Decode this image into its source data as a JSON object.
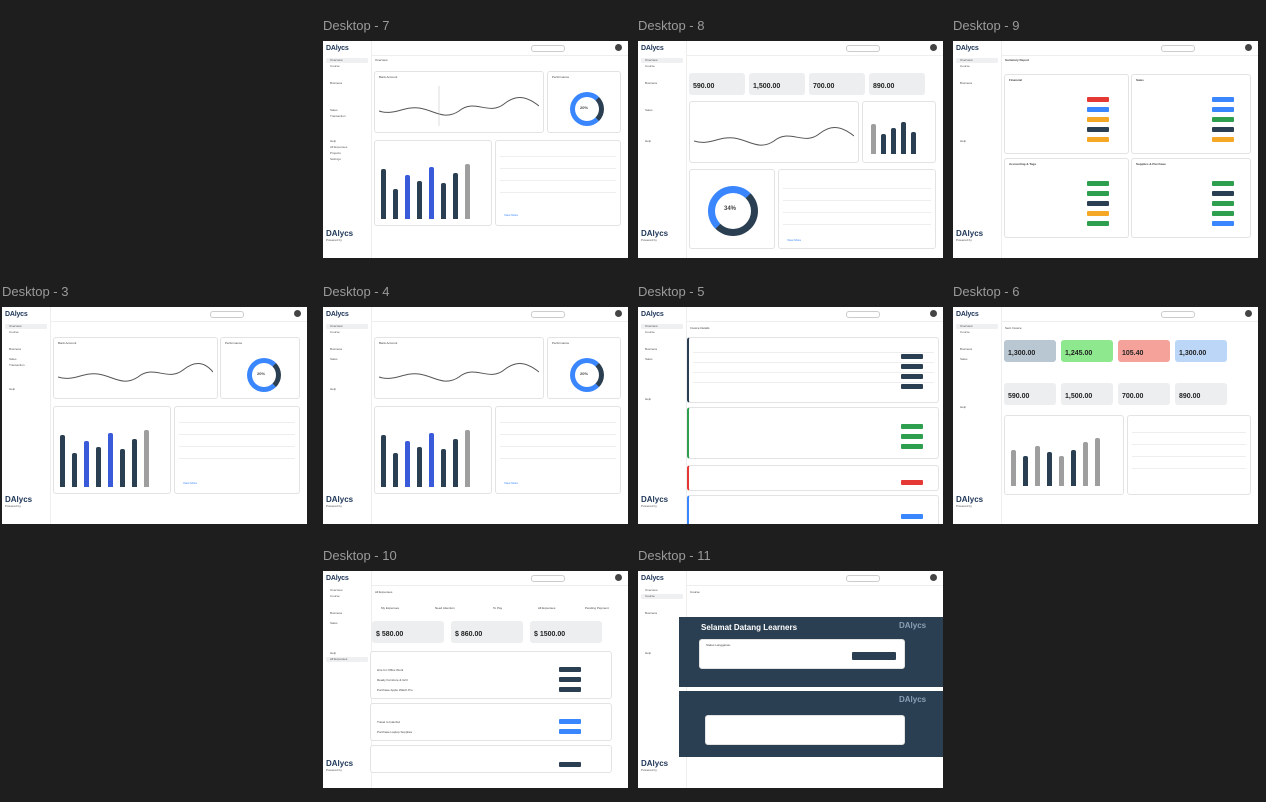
{
  "frames": [
    {
      "label": "Desktop - 7"
    },
    {
      "label": "Desktop - 8"
    },
    {
      "label": "Desktop - 9"
    },
    {
      "label": "Desktop - 3"
    },
    {
      "label": "Desktop - 4"
    },
    {
      "label": "Desktop - 5"
    },
    {
      "label": "Desktop - 6"
    },
    {
      "label": "Desktop - 10"
    },
    {
      "label": "Desktop - 11"
    }
  ],
  "brand": {
    "name": "DAlycs",
    "footer_name": "DAlycs",
    "powered": "Powered by"
  },
  "nav": {
    "overview": "Overview",
    "course": "Course",
    "business": "Business",
    "sales": "Sales",
    "transaction": "Transaction",
    "help": "Help",
    "expenses": "All Expenses",
    "projects": "Projects",
    "settings": "Settings"
  },
  "common": {
    "search": "Search",
    "bank_account": "Bank Account",
    "performance": "Performance",
    "overview": "Overview",
    "view_more": "View More"
  },
  "d8": {
    "stats": [
      "590.00",
      "1,500.00",
      "700.00",
      "890.00"
    ],
    "donut_pct": "34%"
  },
  "d5": {
    "title": "Invoice Details"
  },
  "d6": {
    "title": "Sent Invoice",
    "stats_top": [
      "1,300.00",
      "1,245.00",
      "105.40",
      "1,300.00"
    ],
    "stats_bot": [
      "590.00",
      "1,500.00",
      "700.00",
      "890.00"
    ]
  },
  "d9": {
    "title": "Summary Report",
    "groups": [
      "Financial",
      "Sales",
      "Accounting & Tags",
      "Supplies & Purchase"
    ]
  },
  "d10": {
    "tab": "All Expenses",
    "tabs": [
      "My Expenses",
      "Need Attention",
      "To Pay",
      "All Expenses",
      "Pending Payment"
    ],
    "stats": [
      "$ 580.00",
      "$ 860.00",
      "$ 1500.00"
    ],
    "stat_labels": [
      "Total",
      "Pending",
      "Approved"
    ],
    "items": [
      "Hire for Office Work",
      "Ready Furniture & Grill",
      "Purchase Apple Watch Pro",
      "Travel to Istanbul",
      "Purchase Laptop Supplies"
    ]
  },
  "d11": {
    "tab": "Course",
    "welcome": "Selamat Datang Learners",
    "subtitle": "Status Langganan",
    "brand": "DAlycs"
  },
  "d3": {
    "donut_pct": "20%"
  },
  "d7": {
    "donut_pct": "20%"
  },
  "d4": {
    "donut_pct": "20%"
  }
}
